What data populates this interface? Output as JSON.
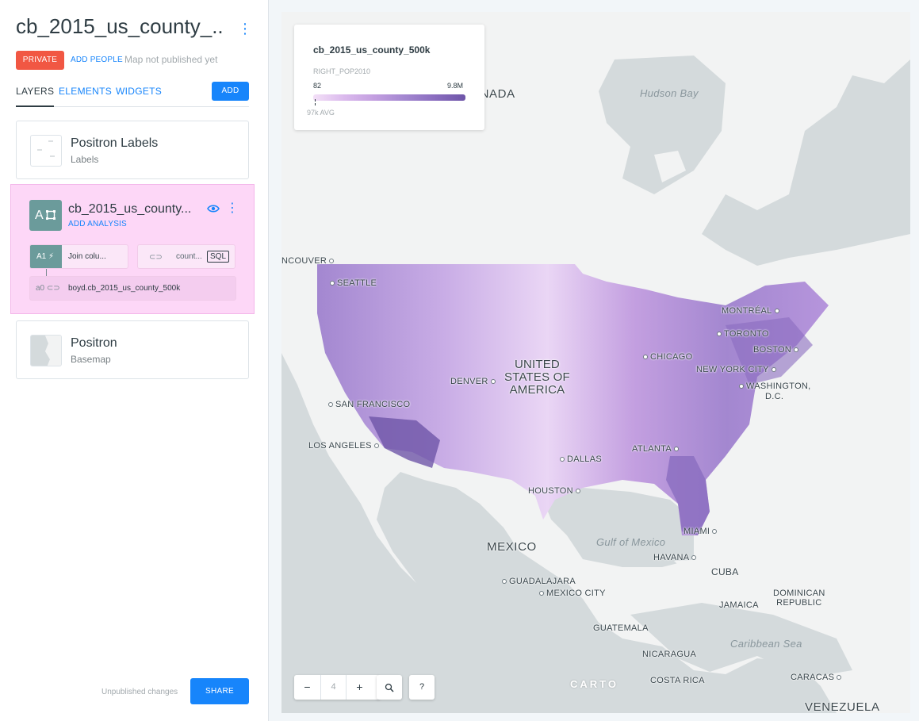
{
  "header": {
    "map_title": "cb_2015_us_county_...",
    "privacy_label": "PRIVATE",
    "add_people_label": "ADD PEOPLE",
    "publish_status": "Map not published yet"
  },
  "tabs": {
    "layers": "LAYERS",
    "elements": "ELEMENTS",
    "widgets": "WIDGETS",
    "add": "ADD"
  },
  "layers": [
    {
      "name": "Positron Labels",
      "subtitle": "Labels"
    },
    {
      "badge": "A",
      "name": "cb_2015_us_county...",
      "add_analysis": "ADD ANALYSIS",
      "nodes": {
        "join_id": "A1 ⚡",
        "join_label": "Join colu...",
        "source_label": "count...",
        "sql_label": "SQL",
        "a0_id": "a0",
        "a0_label": "boyd.cb_2015_us_county_500k"
      }
    },
    {
      "name": "Positron",
      "subtitle": "Basemap"
    }
  ],
  "footer": {
    "unpublished": "Unpublished changes",
    "share": "SHARE"
  },
  "legend": {
    "title": "cb_2015_us_county_500k",
    "field": "RIGHT_POP2010",
    "min": "82",
    "max": "9.8M",
    "avg": "97k AVG",
    "colors": [
      "#f3e0f7",
      "#dbbaed",
      "#c39fe0",
      "#a387d0",
      "#8a6dbf",
      "#6e55a8"
    ]
  },
  "map": {
    "labels": {
      "canada": "ANADA",
      "hudson_bay": "Hudson Bay",
      "vancouver": "NCOUVER",
      "seattle": "SEATTLE",
      "montreal": "MONTRÉAL",
      "toronto": "TORONTO",
      "boston": "BOSTON",
      "chicago": "CHICAGO",
      "new_york": "NEW YORK CITY",
      "washington_1": "WASHINGTON,",
      "washington_2": "D.C.",
      "usa_1": "UNITED",
      "usa_2": "STATES OF",
      "usa_3": "AMERICA",
      "denver": "DENVER",
      "san_francisco": "SAN FRANCISCO",
      "los_angeles": "LOS ANGELES",
      "dallas": "DALLAS",
      "atlanta": "ATLANTA",
      "houston": "HOUSTON",
      "miami": "MIAMI",
      "mexico": "MEXICO",
      "gulf": "Gulf of Mexico",
      "havana": "HAVANA",
      "cuba": "CUBA",
      "guadalajara": "GUADALAJARA",
      "mexico_city": "MEXICO CITY",
      "dominican_1": "DOMINICAN",
      "dominican_2": "REPUBLIC",
      "jamaica": "JAMAICA",
      "guatemala": "GUATEMALA",
      "caribbean": "Caribbean Sea",
      "nicaragua": "NICARAGUA",
      "costa_rica": "COSTA RICA",
      "caracas": "CARACAS",
      "venezuela": "VENEZUELA"
    },
    "zoom_level": "4",
    "zoom_out": "−",
    "zoom_in": "+",
    "search_icon": "magnifier-icon",
    "help": "?",
    "attribution": "CARTO"
  }
}
